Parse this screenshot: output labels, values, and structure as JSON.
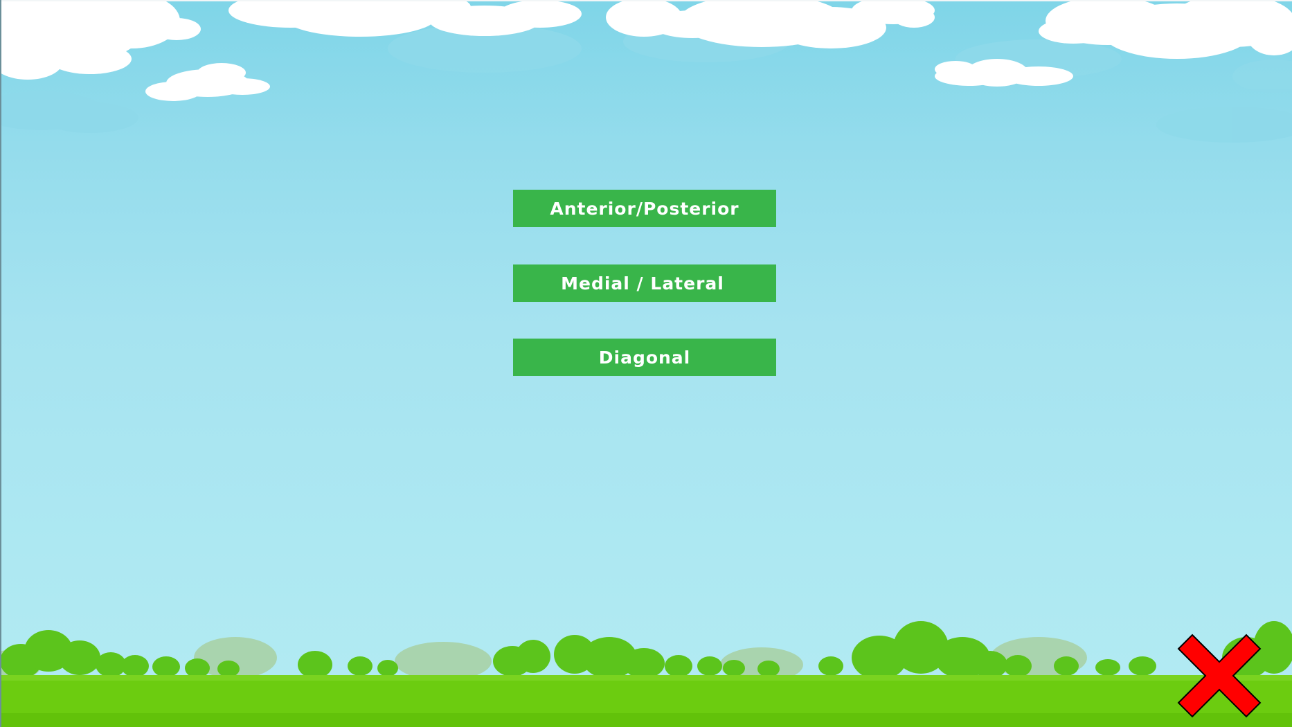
{
  "menu": {
    "buttons": [
      {
        "label": "Anterior/Posterior"
      },
      {
        "label": "Medial / Lateral"
      },
      {
        "label": "Diagonal"
      }
    ]
  },
  "close": {
    "icon": "close-x-icon",
    "color": "#ff0000"
  },
  "colors": {
    "button": "#39b54a",
    "button_text": "#ffffff",
    "sky": "#ade8f2",
    "grass": "#6ccc10"
  }
}
